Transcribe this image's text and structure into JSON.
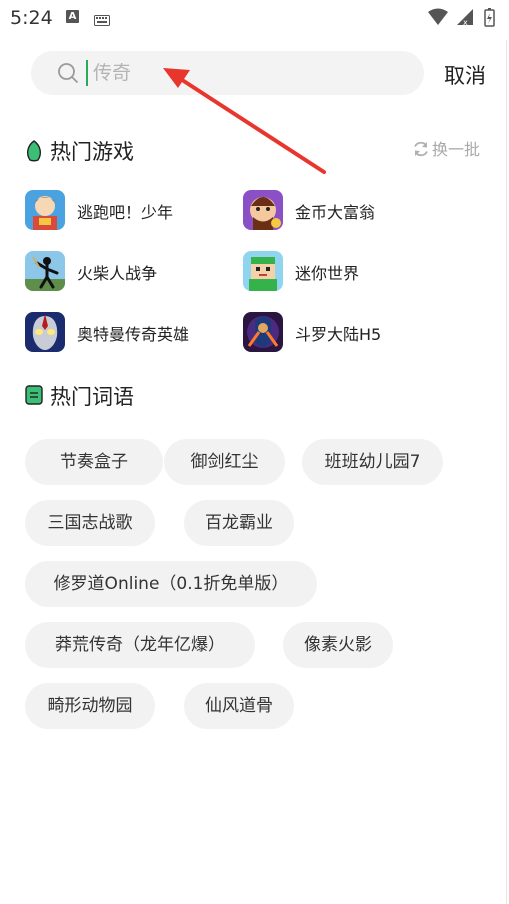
{
  "status_bar": {
    "time": "5:24",
    "a_badge": "A"
  },
  "search": {
    "placeholder": "传奇",
    "cancel_label": "取消"
  },
  "hot_games": {
    "title": "热门游戏",
    "refresh_label": "换一批",
    "items": [
      {
        "name": "逃跑吧！少年",
        "icon": "game-taopaoba-icon"
      },
      {
        "name": "金币大富翁",
        "icon": "game-jinbidafuweng-icon"
      },
      {
        "name": "火柴人战争",
        "icon": "game-huochairen-icon"
      },
      {
        "name": "迷你世界",
        "icon": "game-miniworld-icon"
      },
      {
        "name": "奥特曼传奇英雄",
        "icon": "game-ultraman-icon"
      },
      {
        "name": "斗罗大陆H5",
        "icon": "game-douluo-icon"
      }
    ]
  },
  "hot_words": {
    "title": "热门词语",
    "tags": [
      "节奏盒子",
      "御剑红尘",
      "班班幼儿园7",
      "三国志战歌",
      "百龙霸业",
      "修罗道Online（0.1折免单版）",
      "莽荒传奇（龙年亿爆）",
      "像素火影",
      "畸形动物园",
      "仙风道骨"
    ]
  },
  "colors": {
    "accent": "#2aaa5a",
    "arrow": "#e8362d",
    "tag_bg": "#f2f2f2",
    "search_bg": "#f3f3f3"
  }
}
